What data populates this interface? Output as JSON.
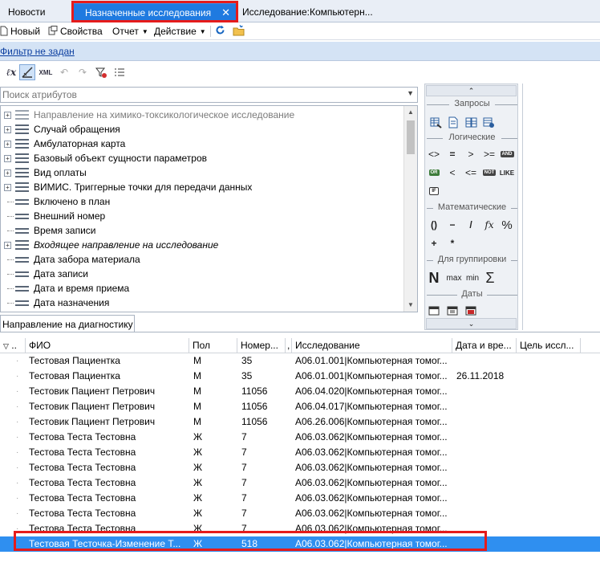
{
  "tabs": [
    {
      "label": "Новости"
    },
    {
      "label": "Назначенные исследования"
    },
    {
      "label": "Исследование:Компьютерн..."
    }
  ],
  "toolbar": {
    "new": "Новый",
    "properties": "Свойства",
    "report": "Отчет",
    "action": "Действие"
  },
  "filter": {
    "label": "Фильтр не задан"
  },
  "search": {
    "placeholder": "Поиск атрибутов"
  },
  "tree": [
    {
      "label": "Направление на химико-токсикологическое исследование",
      "expandable": true,
      "grey": true,
      "italic": false
    },
    {
      "label": "Случай обращения",
      "expandable": true,
      "grey": false,
      "italic": false
    },
    {
      "label": "Амбулаторная карта",
      "expandable": true,
      "grey": false,
      "italic": false
    },
    {
      "label": "Базовый объект сущности параметров",
      "expandable": true,
      "grey": false,
      "italic": false
    },
    {
      "label": "Вид оплаты",
      "expandable": true,
      "grey": false,
      "italic": false
    },
    {
      "label": "ВИМИС. Триггерные точки для передачи данных",
      "expandable": true,
      "grey": false,
      "italic": false
    },
    {
      "label": "Включено в план",
      "expandable": false,
      "grey": false,
      "italic": false
    },
    {
      "label": "Внешний номер",
      "expandable": false,
      "grey": false,
      "italic": false
    },
    {
      "label": "Время записи",
      "expandable": false,
      "grey": false,
      "italic": false
    },
    {
      "label": "Входящее направление на исследование",
      "expandable": true,
      "grey": false,
      "italic": true
    },
    {
      "label": "Дата забора материала",
      "expandable": false,
      "grey": false,
      "italic": false
    },
    {
      "label": "Дата записи",
      "expandable": false,
      "grey": false,
      "italic": false
    },
    {
      "label": "Дата и время приема",
      "expandable": false,
      "grey": false,
      "italic": false
    },
    {
      "label": "Дата назначения",
      "expandable": false,
      "grey": false,
      "italic": false
    }
  ],
  "panel": {
    "queries": "Запросы",
    "logical": "Логические",
    "math": "Математические",
    "grouping": "Для группировки",
    "dates": "Даты",
    "ops_logical_1": [
      "<>",
      "=",
      ">",
      ">="
    ],
    "ops_logical_2": [
      "<",
      "<=",
      "NOT",
      "LIKE"
    ],
    "ops_math_1": [
      "()",
      "−",
      "/",
      "fx",
      "%"
    ],
    "ops_math_2": [
      "+",
      "*"
    ],
    "ops_group": [
      "N",
      "max",
      "min",
      "Σ"
    ],
    "tag_and": "AND",
    "tag_or": "OR",
    "tag_if": "IF"
  },
  "lower_tab": {
    "label": "Направление на диагностику"
  },
  "grid": {
    "headers": [
      "..",
      "ФИО",
      "Пол",
      "Номер...",
      "Исследование",
      "Дата и вре...",
      "Цель иссл..."
    ],
    "rows": [
      [
        "Тестовая Пациентка",
        "М",
        "35",
        "A06.01.001|Компьютерная томог...",
        ""
      ],
      [
        "Тестовая Пациентка",
        "М",
        "35",
        "A06.01.001|Компьютерная томог...",
        "26.11.2018"
      ],
      [
        "Тестовик Пациент Петрович",
        "М",
        "11056",
        "A06.04.020|Компьютерная томог...",
        ""
      ],
      [
        "Тестовик Пациент Петрович",
        "М",
        "11056",
        "A06.04.017|Компьютерная томог...",
        ""
      ],
      [
        "Тестовик Пациент Петрович",
        "М",
        "11056",
        "A06.26.006|Компьютерная томог...",
        ""
      ],
      [
        "Тестова Теста Тестовна",
        "Ж",
        "7",
        "A06.03.062|Компьютерная томог...",
        ""
      ],
      [
        "Тестова Теста Тестовна",
        "Ж",
        "7",
        "A06.03.062|Компьютерная томог...",
        ""
      ],
      [
        "Тестова Теста Тестовна",
        "Ж",
        "7",
        "A06.03.062|Компьютерная томог...",
        ""
      ],
      [
        "Тестова Теста Тестовна",
        "Ж",
        "7",
        "A06.03.062|Компьютерная томог...",
        ""
      ],
      [
        "Тестова Теста Тестовна",
        "Ж",
        "7",
        "A06.03.062|Компьютерная томог...",
        ""
      ],
      [
        "Тестова Теста Тестовна",
        "Ж",
        "7",
        "A06.03.062|Компьютерная томог...",
        ""
      ],
      [
        "Тестова Теста Тестовна",
        "Ж",
        "7",
        "A06.03.062|Компьютерная томог...",
        ""
      ],
      [
        "Тестовая Тесточка-Изменение Т...",
        "Ж",
        "518",
        "A06.03.062|Компьютерная томог...",
        ""
      ]
    ],
    "selected_row": 12
  },
  "colors": {
    "accent": "#1f7ae0",
    "highlight": "#e51b1b",
    "selection": "#2f8ff0"
  }
}
